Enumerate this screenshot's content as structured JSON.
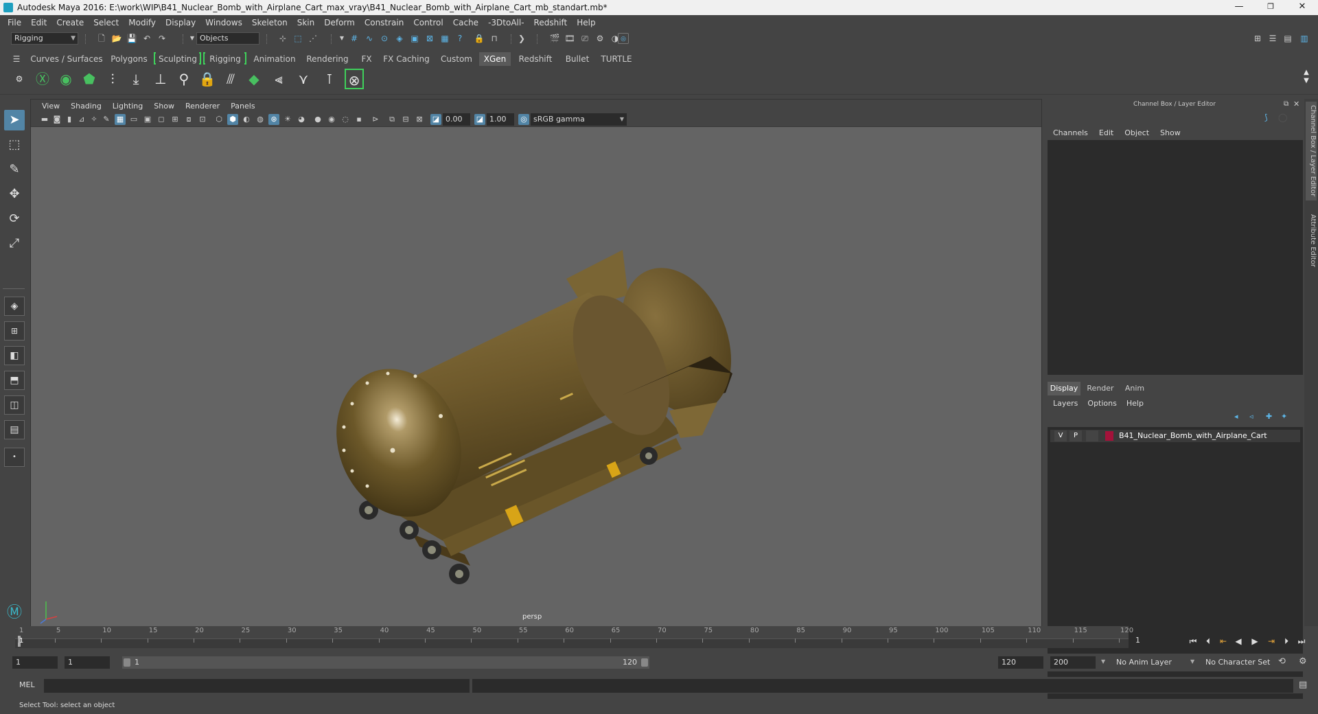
{
  "window": {
    "title": "Autodesk Maya 2016: E:\\work\\WIP\\B41_Nuclear_Bomb_with_Airplane_Cart_max_vray\\B41_Nuclear_Bomb_with_Airplane_Cart_mb_standart.mb*",
    "minimize": "—",
    "restore": "❐",
    "close": "✕"
  },
  "menubar": [
    "File",
    "Edit",
    "Create",
    "Select",
    "Modify",
    "Display",
    "Windows",
    "Skeleton",
    "Skin",
    "Deform",
    "Constrain",
    "Control",
    "Cache",
    "-3DtoAll-",
    "Redshift",
    "Help"
  ],
  "statusline": {
    "menu_set": "Rigging",
    "selection_mode": "Objects"
  },
  "shelf": {
    "tabs": [
      "Curves / Surfaces",
      "Polygons",
      "Sculpting",
      "Rigging",
      "Animation",
      "Rendering",
      "FX",
      "FX Caching",
      "Custom",
      "XGen",
      "Redshift",
      "Bullet",
      "TURTLE"
    ],
    "active_tab": "XGen"
  },
  "viewport": {
    "menu": [
      "View",
      "Shading",
      "Lighting",
      "Show",
      "Renderer",
      "Panels"
    ],
    "exposure": "0.00",
    "gamma": "1.00",
    "color_space": "sRGB gamma",
    "camera_label": "persp"
  },
  "channel_box": {
    "title": "Channel Box / Layer Editor",
    "menu": [
      "Channels",
      "Edit",
      "Object",
      "Show"
    ]
  },
  "layer_editor": {
    "tabs": [
      "Display",
      "Render",
      "Anim"
    ],
    "active_tab": "Display",
    "menu": [
      "Layers",
      "Options",
      "Help"
    ],
    "layers": [
      {
        "visible": "V",
        "playback": "P",
        "name": "B41_Nuclear_Bomb_with_Airplane_Cart",
        "color": "#a4123a"
      }
    ]
  },
  "side_tabs": [
    "Channel Box / Layer Editor",
    "Attribute Editor"
  ],
  "time_slider": {
    "ticks": [
      "1",
      "5",
      "10",
      "15",
      "20",
      "25",
      "30",
      "35",
      "40",
      "45",
      "50",
      "55",
      "60",
      "65",
      "70",
      "75",
      "80",
      "85",
      "90",
      "95",
      "100",
      "105",
      "110",
      "115",
      "120"
    ],
    "current_frame": "1"
  },
  "range_slider": {
    "start_frame": "1",
    "playback_start": "1",
    "range_start": "1",
    "range_end": "120",
    "playback_end": "120",
    "end_frame": "200",
    "anim_layer": "No Anim Layer",
    "character_set": "No Character Set"
  },
  "command_line": {
    "label": "MEL",
    "value": ""
  },
  "help_line": {
    "text": "Select Tool: select an object"
  },
  "colors": {
    "bomb": "#7a6331",
    "accent": "#5285a6",
    "shelf_bracket": "#3fd15b",
    "layer_color": "#a4123a"
  }
}
